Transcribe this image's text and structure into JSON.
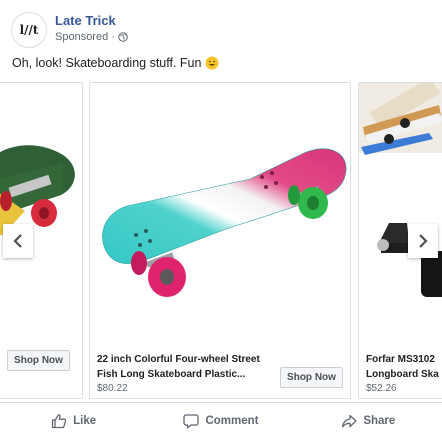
{
  "post": {
    "page_name": "Late Trick",
    "avatar_text": "l//t",
    "sponsored_label": "Sponsored",
    "separator": "·",
    "privacy_icon": "globe-icon",
    "text": "Oh, look! Skateboarding stuff. Fun",
    "emoji": "smiling-face-emoji"
  },
  "carousel": {
    "prev_icon": "chevron-left-icon",
    "next_icon": "chevron-right-icon",
    "cards": [
      {
        "title_1": "",
        "title_2": "",
        "price": "",
        "cta": "Shop Now",
        "image": "skateboard-green-red"
      },
      {
        "title_1": "22 inch Colorful Four-wheel Street",
        "title_2": "Fish Long Skateboard Plastic...",
        "price": "$80.22",
        "cta": "Shop Now",
        "image": "skateboard-teal-pink"
      },
      {
        "title_1": "Forfar MS3102",
        "title_2": "Longboard Ska",
        "price": "$52.26",
        "cta": "",
        "image": "skateboard-display-rack"
      }
    ]
  },
  "actions": [
    {
      "label": "Like",
      "icon": "thumbs-up-icon"
    },
    {
      "label": "Comment",
      "icon": "comment-icon"
    },
    {
      "label": "Share",
      "icon": "share-icon"
    }
  ],
  "colors": {
    "link": "#385898",
    "muted": "#606770",
    "border": "#dadde1"
  }
}
